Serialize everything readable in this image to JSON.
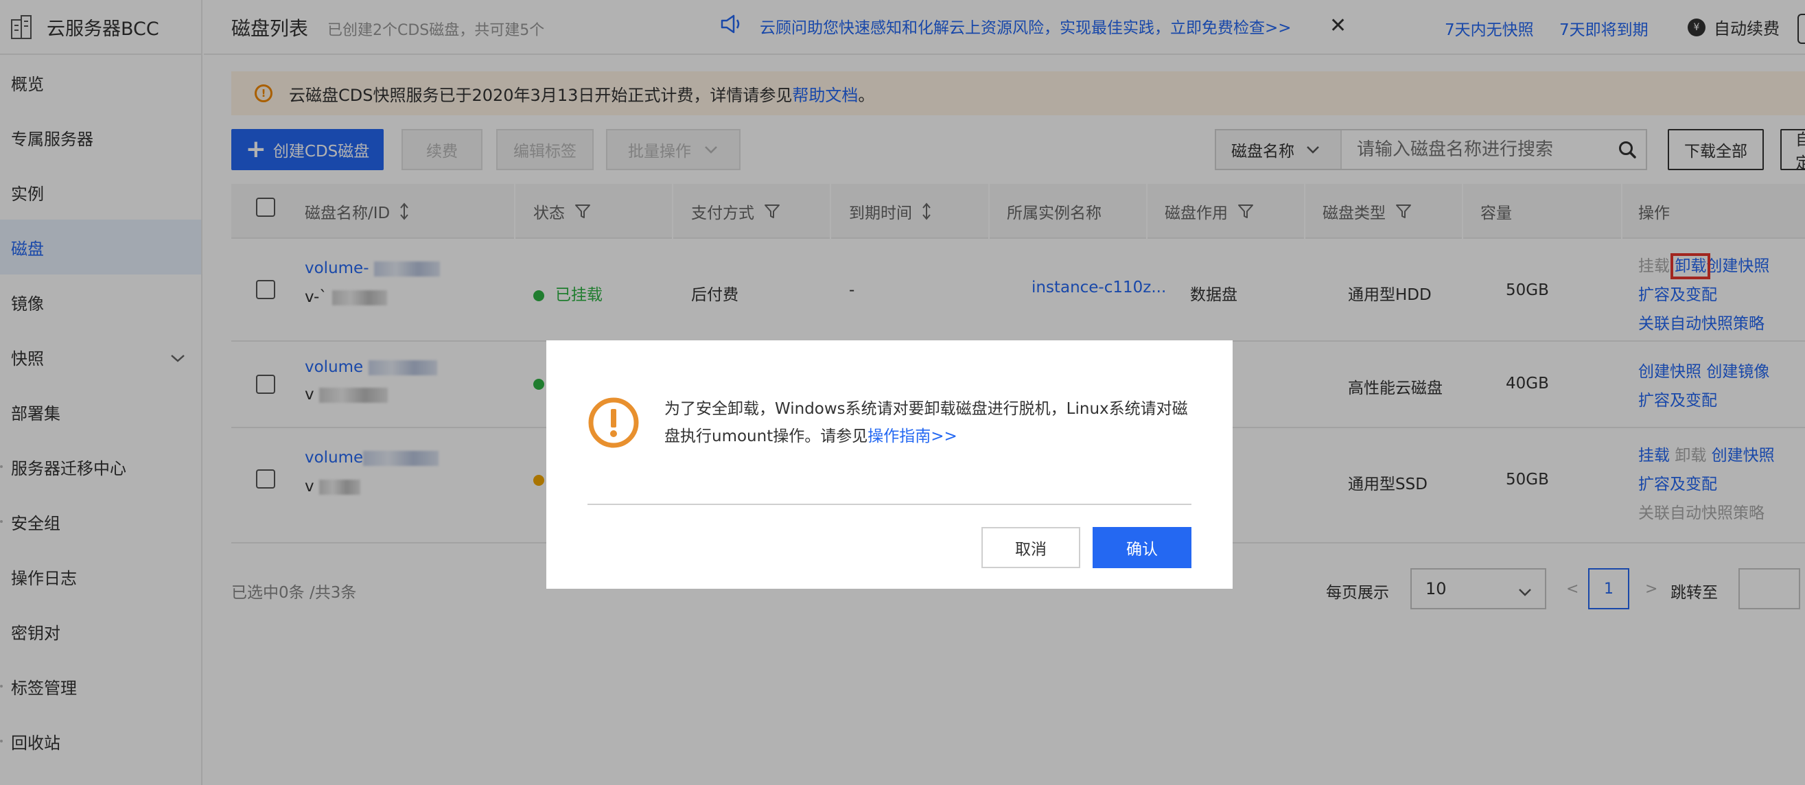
{
  "sidebar": {
    "title": "云服务器BCC",
    "items": [
      {
        "label": "概览"
      },
      {
        "label": "专属服务器"
      },
      {
        "label": "实例"
      },
      {
        "label": "磁盘"
      },
      {
        "label": "镜像"
      },
      {
        "label": "快照"
      },
      {
        "label": "部署集"
      },
      {
        "label": "服务器迁移中心"
      },
      {
        "label": "安全组"
      },
      {
        "label": "操作日志"
      },
      {
        "label": "密钥对"
      },
      {
        "label": "标签管理"
      },
      {
        "label": "回收站"
      }
    ]
  },
  "header": {
    "title": "磁盘列表",
    "subtitle": "已创建2个CDS磁盘，共可建5个",
    "promo": "云顾问助您快速感知和化解云上资源风险，实现最佳实践，立即免费检查>>",
    "close": "✕",
    "link_no_snapshot": "7天内无快照",
    "link_expiring": "7天即将到期",
    "auto_renew": "自动续费",
    "coin": "¥"
  },
  "notice": {
    "text": "云磁盘CDS快照服务已于2020年3月13日开始正式计费，详情请参见",
    "link": "帮助文档",
    "suffix": "。"
  },
  "toolbar": {
    "create": "创建CDS磁盘",
    "renew": "续费",
    "edit_tags": "编辑标签",
    "batch": "批量操作",
    "search_field": "磁盘名称",
    "search_placeholder": "请输入磁盘名称进行搜索",
    "download_all": "下载全部",
    "custom": "自定"
  },
  "table": {
    "headers": {
      "name": "磁盘名称/ID",
      "status": "状态",
      "payment": "支付方式",
      "expire": "到期时间",
      "instance": "所属实例名称",
      "usage": "磁盘作用",
      "type": "磁盘类型",
      "capacity": "容量",
      "ops": "操作"
    },
    "rows": [
      {
        "name": "volume-",
        "id": "v-`",
        "status": "已挂载",
        "payment": "后付费",
        "expire": "-",
        "instance": "instance-c110z...",
        "usage": "数据盘",
        "type": "通用型HDD",
        "capacity": "50GB",
        "ops": [
          "挂载",
          "卸载",
          "创建快照",
          "扩容及变配",
          "关联自动快照策略"
        ]
      },
      {
        "name": "volume",
        "id": "v",
        "type": "高性能云磁盘",
        "capacity": "40GB",
        "ops": [
          "创建快照",
          "创建镜像",
          "扩容及变配"
        ]
      },
      {
        "name": "volume",
        "id": "v",
        "type": "通用型SSD",
        "capacity": "50GB",
        "ops": [
          "挂载",
          "卸载",
          "创建快照",
          "扩容及变配",
          "关联自动快照策略"
        ]
      }
    ]
  },
  "footer": {
    "selected": "已选中0条 /共3条",
    "page_size_label": "每页展示",
    "page_size": "10",
    "prev": "<",
    "current_page": "1",
    "next": ">",
    "jump_label": "跳转至"
  },
  "dialog": {
    "message": "为了安全卸载，Windows系统请对要卸载磁盘进行脱机，Linux系统请对磁盘执行umount操作。请参见",
    "guide_link": "操作指南>>",
    "cancel": "取消",
    "confirm": "确认"
  },
  "colors": {
    "primary": "#2468f2",
    "warning": "#f38900",
    "success": "#2fb344",
    "dialog_icon": "#e8902e",
    "highlight_box": "#e8372e"
  }
}
